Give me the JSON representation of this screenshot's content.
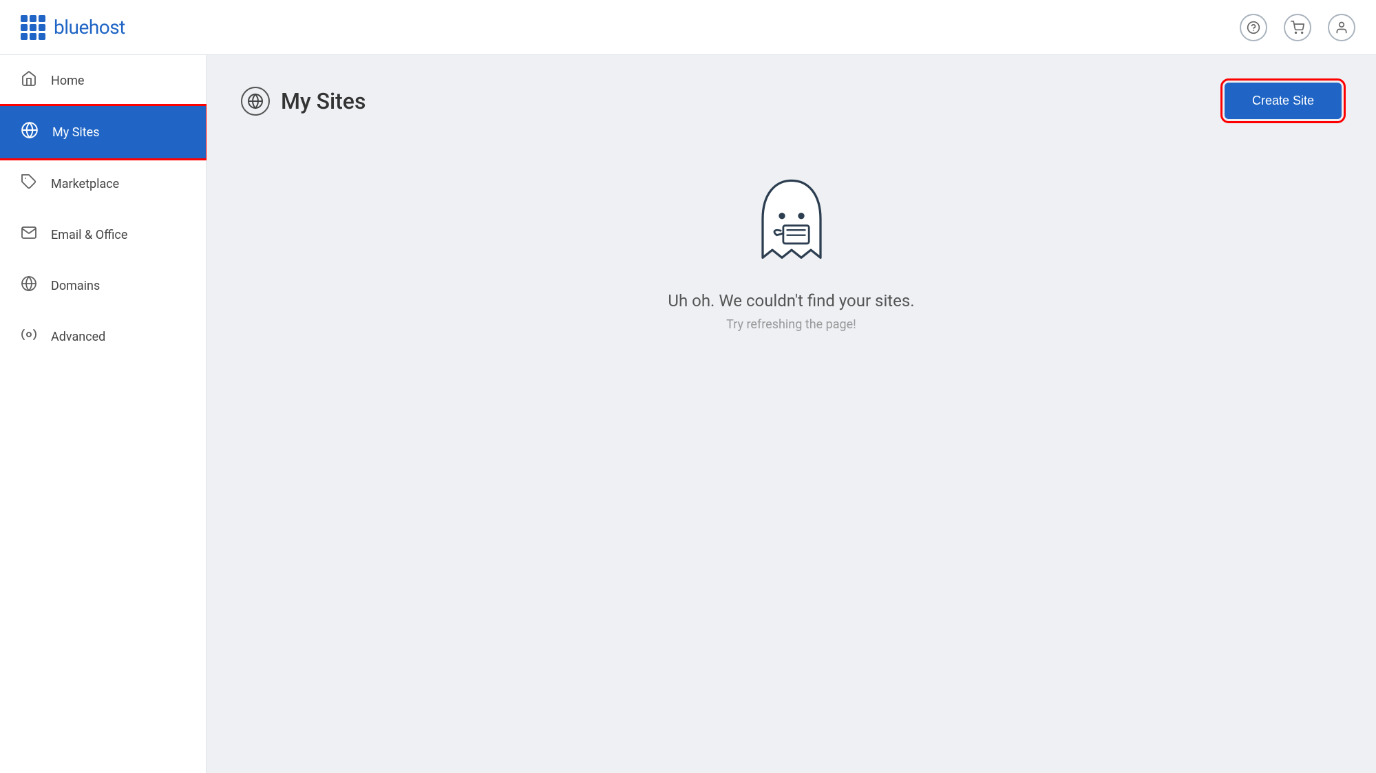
{
  "header": {
    "logo_text": "bluehost"
  },
  "sidebar": {
    "items": [
      {
        "id": "home",
        "label": "Home",
        "icon": "🏠",
        "active": false
      },
      {
        "id": "my-sites",
        "label": "My Sites",
        "icon": "W",
        "active": true
      },
      {
        "id": "marketplace",
        "label": "Marketplace",
        "icon": "🏷",
        "active": false
      },
      {
        "id": "email-office",
        "label": "Email & Office",
        "icon": "✉",
        "active": false
      },
      {
        "id": "domains",
        "label": "Domains",
        "icon": "⊙",
        "active": false
      },
      {
        "id": "advanced",
        "label": "Advanced",
        "icon": "⚛",
        "active": false
      }
    ]
  },
  "main": {
    "page_title": "My Sites",
    "create_site_label": "Create Site",
    "empty_title": "Uh oh. We couldn't find your sites.",
    "empty_subtitle": "Try refreshing the page!"
  }
}
